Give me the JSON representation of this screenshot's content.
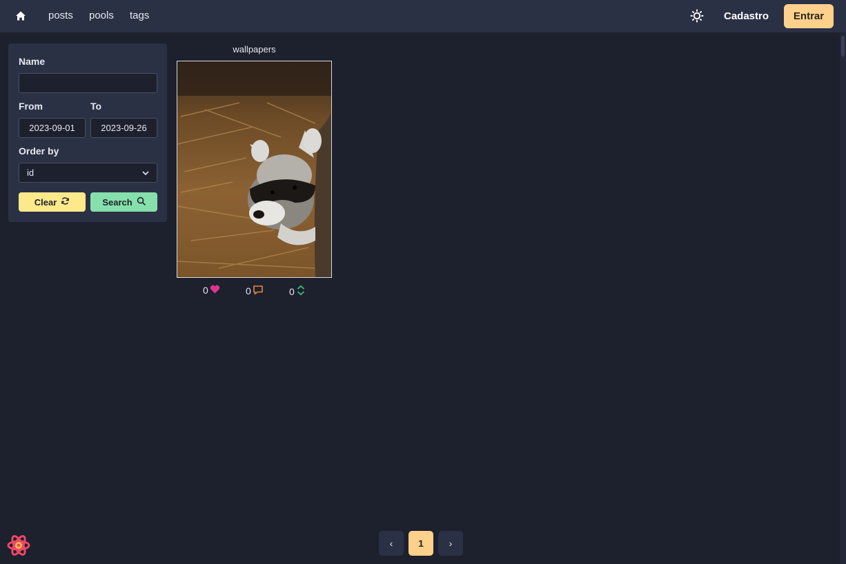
{
  "navbar": {
    "links": [
      "posts",
      "pools",
      "tags"
    ],
    "signup_label": "Cadastro",
    "login_label": "Entrar"
  },
  "filters": {
    "name_label": "Name",
    "name_value": "",
    "from_label": "From",
    "from_value": "2023-09-01",
    "to_label": "To",
    "to_value": "2023-09-26",
    "order_label": "Order by",
    "order_value": "id",
    "clear_label": "Clear",
    "search_label": "Search"
  },
  "post": {
    "title": "wallpapers",
    "likes": "0",
    "comments": "0",
    "votes": "0"
  },
  "pagination": {
    "prev": "‹",
    "current": "1",
    "next": "›"
  },
  "colors": {
    "background": "#1d202d",
    "surface": "#2b3144",
    "accent": "#fdd08c",
    "clear": "#fce98a",
    "search": "#86e0ab",
    "like": "#e0358f",
    "comment": "#e8893a",
    "vote": "#3ec07a"
  },
  "icons": {
    "home": "home-icon",
    "theme": "sun-icon",
    "clear": "refresh-icon",
    "search": "search-icon",
    "like": "heart-icon",
    "comment": "comment-icon",
    "vote": "updown-icon",
    "select": "chevron-down-icon",
    "logo": "react-logo"
  }
}
